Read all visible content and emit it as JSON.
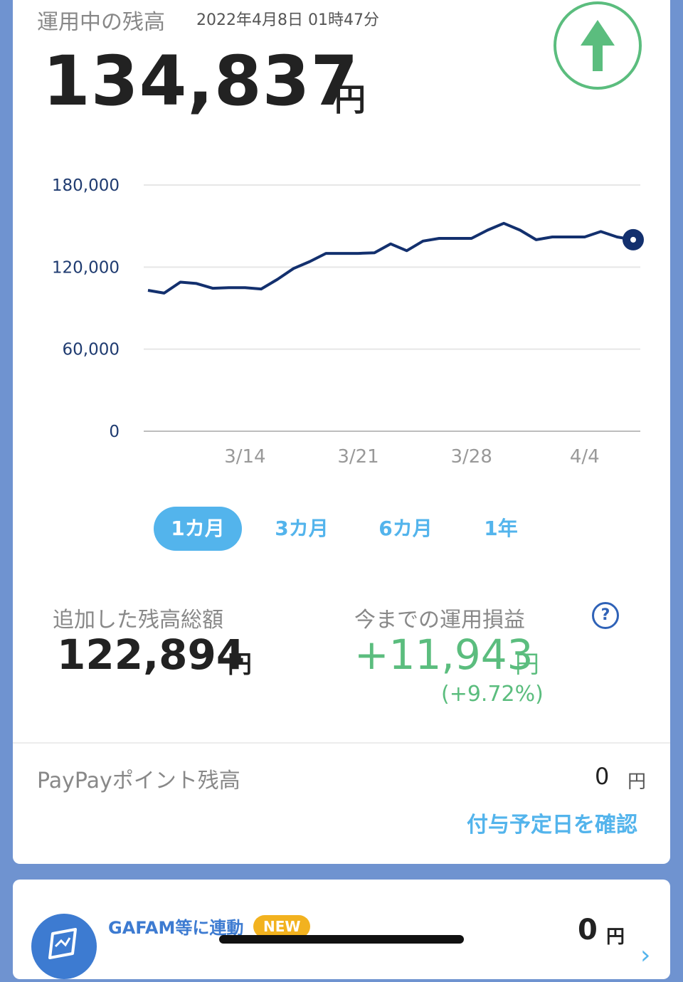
{
  "header": {
    "label": "運用中の残高",
    "timestamp": "2022年4月8日 01時47分",
    "amount": "134,837",
    "unit": "円"
  },
  "chart_data": {
    "type": "line",
    "x": [
      "3/8",
      "3/9",
      "3/10",
      "3/11",
      "3/12",
      "3/13",
      "3/14",
      "3/15",
      "3/16",
      "3/17",
      "3/18",
      "3/19",
      "3/20",
      "3/21",
      "3/22",
      "3/23",
      "3/24",
      "3/25",
      "3/26",
      "3/27",
      "3/28",
      "3/29",
      "3/30",
      "3/31",
      "4/1",
      "4/2",
      "4/3",
      "4/4",
      "4/5",
      "4/6",
      "4/7"
    ],
    "series": [
      {
        "values": [
          103000,
          101000,
          109000,
          108000,
          104500,
          105000,
          105000,
          104000,
          111000,
          119000,
          124000,
          130000,
          130000,
          130000,
          130500,
          137000,
          132000,
          139000,
          141000,
          141000,
          141000,
          147000,
          152000,
          147000,
          140000,
          142000,
          142000,
          142000,
          146000,
          142000,
          140000
        ]
      }
    ],
    "x_ticks": [
      "3/14",
      "3/21",
      "3/28",
      "4/4"
    ],
    "y_ticks": [
      "0",
      "60,000",
      "120,000",
      "180,000"
    ],
    "ylim": [
      0,
      180000
    ],
    "grid": true,
    "line_color": "#13306e"
  },
  "periods": {
    "p1": "1カ月",
    "p2": "3カ月",
    "p3": "6カ月",
    "p4": "1年",
    "active": "1カ月"
  },
  "summary": {
    "added_label": "追加した残高総額",
    "added_value": "122,894",
    "added_unit": "円",
    "pl_label": "今までの運用損益",
    "pl_value": "+11,943",
    "pl_unit": "円",
    "pl_percent": "(+9.72%)",
    "help": "?"
  },
  "paypay": {
    "label": "PayPayポイント残高",
    "value": "0",
    "unit": "円",
    "link": "付与予定日を確認"
  },
  "gafam": {
    "title": "GAFAM等に連動",
    "badge": "NEW",
    "value": "0",
    "unit": "円",
    "chevron": "›"
  },
  "colors": {
    "accent": "#53b4ec",
    "positive": "#5bbd7e",
    "line": "#13306e",
    "background": "#6f93d0"
  },
  "icons": {
    "up": "arrow-up-icon",
    "help": "question-circle-icon",
    "gafam": "flag-chart-icon",
    "next": "chevron-right-icon"
  }
}
